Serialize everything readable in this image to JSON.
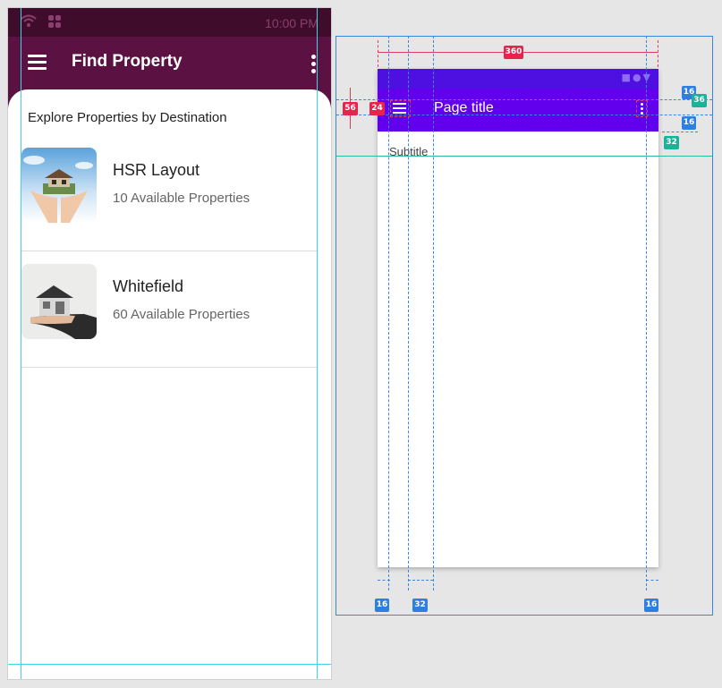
{
  "status_bar": {
    "time": "10:00 PM",
    "wifi_icon": "wifi-icon",
    "apps_icon": "grid-icon"
  },
  "app_bar": {
    "title": "Find Property",
    "menu_icon": "hamburger-menu-icon",
    "more_icon": "more-vert-icon"
  },
  "content": {
    "heading": "Explore Properties by Destination",
    "properties": [
      {
        "name": "HSR Layout",
        "count": "10 Available Properties",
        "image": "house-in-hands-image"
      },
      {
        "name": "Whitefield",
        "count": "60 Available Properties",
        "image": "house-on-hand-image"
      }
    ]
  },
  "spec": {
    "title": "Page title",
    "subtitle": "Subtitle",
    "measurements": {
      "width": "360",
      "appbar_height": "56",
      "icon_size": "24",
      "status_gap": "16",
      "right_height": "36",
      "title_gap": "16",
      "corner": "32",
      "margin_left": "16",
      "title_offset": "32",
      "margin_right": "16"
    }
  },
  "colors": {
    "status_bar": "#3f0c2c",
    "app_bar": "#5b1142",
    "spec_primary": "#6200ee",
    "guide": "#37d9e6",
    "spec_blue": "#2f7fe0",
    "spec_red": "#e8244d",
    "spec_teal": "#19b39a"
  }
}
